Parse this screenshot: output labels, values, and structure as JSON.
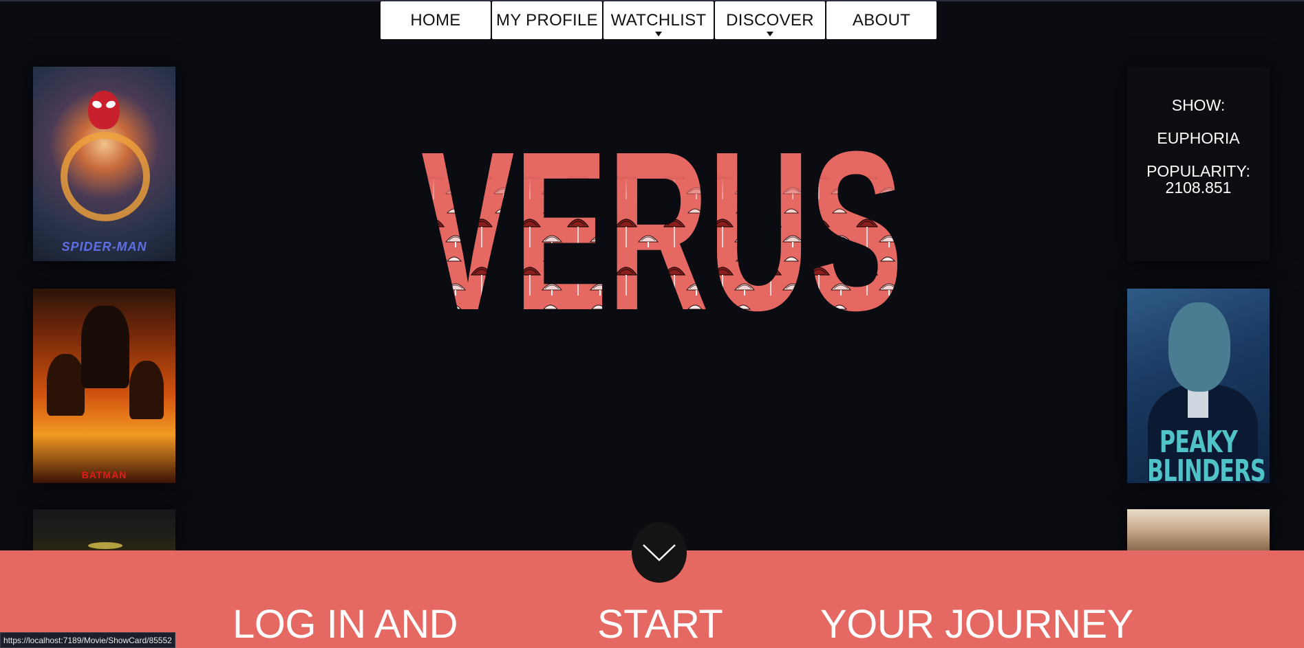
{
  "nav": {
    "items": [
      {
        "label": "HOME",
        "has_dropdown": false
      },
      {
        "label": "MY PROFILE",
        "has_dropdown": false
      },
      {
        "label": "WATCHLIST",
        "has_dropdown": true
      },
      {
        "label": "DISCOVER",
        "has_dropdown": true
      },
      {
        "label": "ABOUT",
        "has_dropdown": false
      }
    ]
  },
  "hero": {
    "title": "VERUS",
    "accent_color": "#e66863"
  },
  "left_posters": [
    {
      "name": "spider-man-poster",
      "text": "SPIDER-MAN"
    },
    {
      "name": "the-batman-poster",
      "text": "BATMAN"
    },
    {
      "name": "dark-poster",
      "text": ""
    }
  ],
  "right_column": {
    "info_card": {
      "show_label": "SHOW:",
      "show_name": "EUPHORIA",
      "popularity_label": "POPULARITY:",
      "popularity_value": "2108.851"
    },
    "peaky_poster_text_1": "PEAKY",
    "peaky_poster_text_2": "BLINDERS"
  },
  "cta": {
    "word_1": "LOG IN AND",
    "word_2": "START",
    "word_3": "YOUR JOURNEY",
    "scroll_icon": "chevron-down-icon"
  },
  "status_bar": {
    "url": "https://localhost:7189/Movie/ShowCard/85552"
  }
}
